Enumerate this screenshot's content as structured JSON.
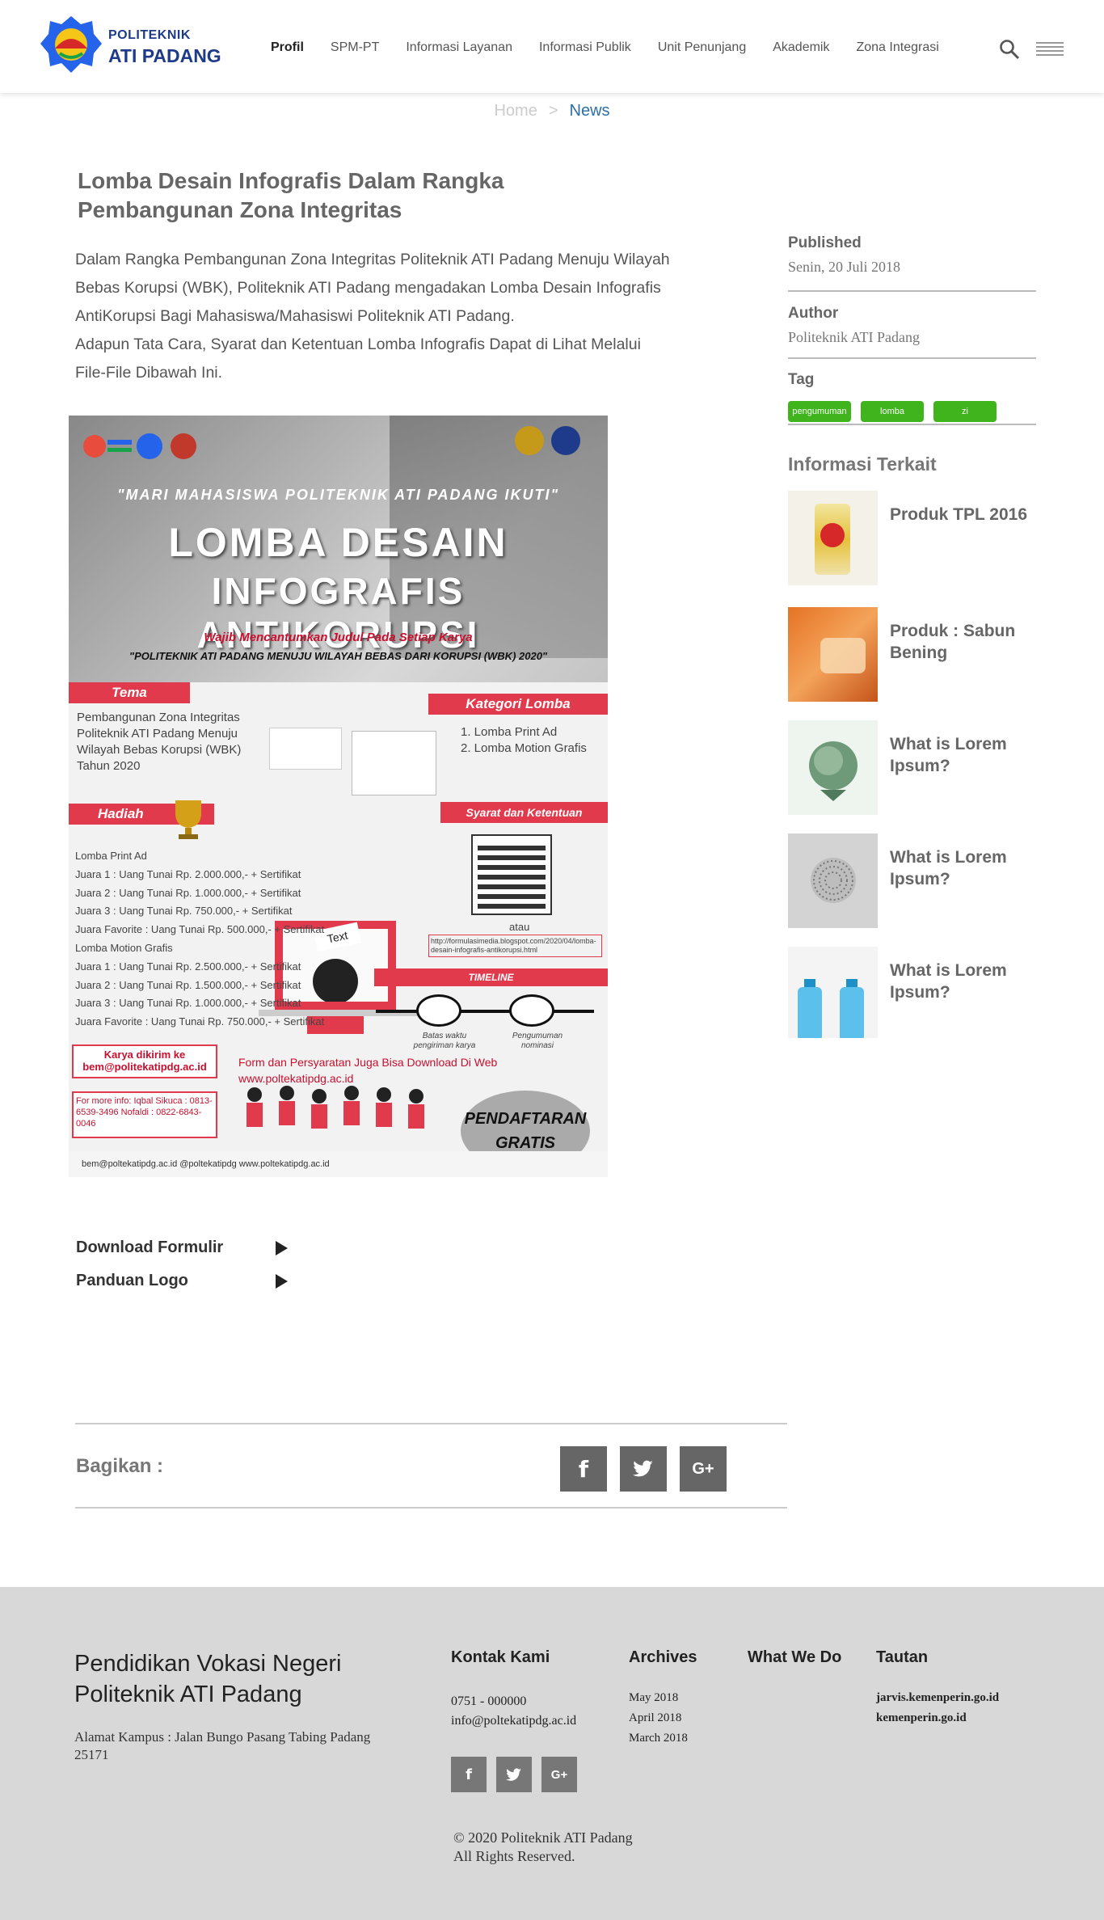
{
  "header": {
    "logo_line1": "POLITEKNIK",
    "logo_line2": "ATI PADANG",
    "nav": [
      "Profil",
      "SPM-PT",
      "Informasi Layanan",
      "Informasi Publik",
      "Unit Penunjang",
      "Akademik",
      "Zona Integrasi"
    ],
    "search_icon": "search-icon",
    "menu_icon": "hamburger-icon"
  },
  "breadcrumb": {
    "home": "Home",
    "sep": ">",
    "current": "News"
  },
  "article": {
    "title": "Lomba Desain Infografis Dalam Rangka Pembangunan Zona Integritas",
    "paragraph1": "Dalam Rangka Pembangunan Zona Integritas Politeknik ATI Padang Menuju Wilayah Bebas Korupsi (WBK), Politeknik ATI Padang mengadakan Lomba Desain Infografis AntiKorupsi Bagi Mahasiswa/Mahasiswi Politeknik ATI Padang.",
    "paragraph2": "Adapun Tata Cara, Syarat dan Ketentuan Lomba Infografis Dapat di Lihat Melalui File-File Dibawah Ini."
  },
  "poster": {
    "cap_top": "\"MARI MAHASISWA POLITEKNIK ATI PADANG IKUTI\"",
    "big1": "LOMBA DESAIN",
    "big2": "INFOGRAFIS ANTIKORUPSI",
    "wajib": "Wajib Mencantumkan Judul Pada Setiap Karya",
    "sub": "\"POLITEKNIK ATI PADANG MENUJU WILAYAH BEBAS DARI KORUPSI (WBK) 2020\"",
    "tema_label": "Tema",
    "tema_text": "Pembangunan Zona Integritas Politeknik ATI Padang Menuju Wilayah Bebas Korupsi (WBK) Tahun 2020",
    "kategori_label": "Kategori Lomba",
    "kategori_1": "1. Lomba Print Ad",
    "kategori_2": "2. Lomba Motion Grafis",
    "hadiah_label": "Hadiah",
    "syarat_label": "Syarat dan Ketentuan",
    "atau": "atau",
    "link": "http://formulasimedia.blogspot.com/2020/04/lomba-desain-infografis-antikorupsi.html",
    "laptop_text": "Text",
    "prizes": [
      "Lomba Print Ad",
      "Juara 1 : Uang Tunai Rp. 2.000.000,- + Sertifikat",
      "Juara 2 : Uang Tunai Rp. 1.000.000,- + Sertifikat",
      "Juara 3 : Uang Tunai Rp. 750.000,- + Sertifikat",
      "Juara Favorite : Uang Tunai Rp. 500.000,- + Sertifikat",
      "Lomba Motion Grafis",
      "Juara 1 : Uang Tunai Rp. 2.500.000,- + Sertifikat",
      "Juara 2 : Uang Tunai Rp. 1.500.000,- + Sertifikat",
      "Juara 3 : Uang Tunai Rp. 1.000.000,- + Sertifikat",
      "Juara Favorite : Uang Tunai Rp. 750.000,- + Sertifikat"
    ],
    "timeline_label": "TIMELINE",
    "timeline_1": "Batas waktu pengiriman karya",
    "timeline_2": "Pengumuman nominasi",
    "karya": "Karya dikirim ke bem@politekatipdg.ac.id",
    "form_text": "Form dan Persyaratan Juga Bisa Download Di Web www.poltekatipdg.ac.id",
    "contact": "For more info: Iqbal Sikuca : 0813-6539-3496 Nofaldi : 0822-6843-0046",
    "daftar": "PENDAFTARAN GRATIS",
    "footer_strip": "bem@poltekatipdg.ac.id   @poltekatipdg   www.poltekatipdg.ac.id"
  },
  "downloads": [
    {
      "label": "Download Formulir"
    },
    {
      "label": "Panduan Logo"
    }
  ],
  "share": {
    "label": "Bagikan :",
    "buttons": [
      "f",
      "t",
      "G+"
    ]
  },
  "sidebar": {
    "published_label": "Published",
    "published_value": "Senin, 20 Juli 2018",
    "author_label": "Author",
    "author_value": "Politeknik ATI Padang",
    "tag_label": "Tag",
    "tags": [
      "pengumuman",
      "lomba",
      "zi"
    ],
    "related_heading": "Informasi Terkait",
    "related": [
      {
        "title": "Produk TPL 2016"
      },
      {
        "title": "Produk : Sabun Bening"
      },
      {
        "title": "What is Lorem Ipsum?"
      },
      {
        "title": "What is Lorem Ipsum?"
      },
      {
        "title": "What is Lorem Ipsum?"
      }
    ]
  },
  "footer": {
    "heading": "Pendidikan Vokasi Negeri Politeknik ATI Padang",
    "address": "Alamat Kampus : Jalan Bungo Pasang Tabing Padang 25171",
    "contact_head": "Kontak Kami",
    "phone": "0751 - 000000",
    "email": "info@poltekatipdg.ac.id",
    "archives_head": "Archives",
    "archives": [
      "May 2018",
      "April 2018",
      "March 2018"
    ],
    "whatwedo_head": "What We Do",
    "tautan_head": "Tautan",
    "links": [
      "jarvis.kemenperin.go.id",
      "kemenperin.go.id"
    ],
    "copyright_1": "© 2020 Politeknik ATI Padang",
    "copyright_2": "All Rights Reserved."
  },
  "colors": {
    "brand": "#1e3a8a",
    "accent_link": "#2c6fa6",
    "tag_green": "#3fb41c",
    "footer_bg": "#d8d8d8"
  }
}
